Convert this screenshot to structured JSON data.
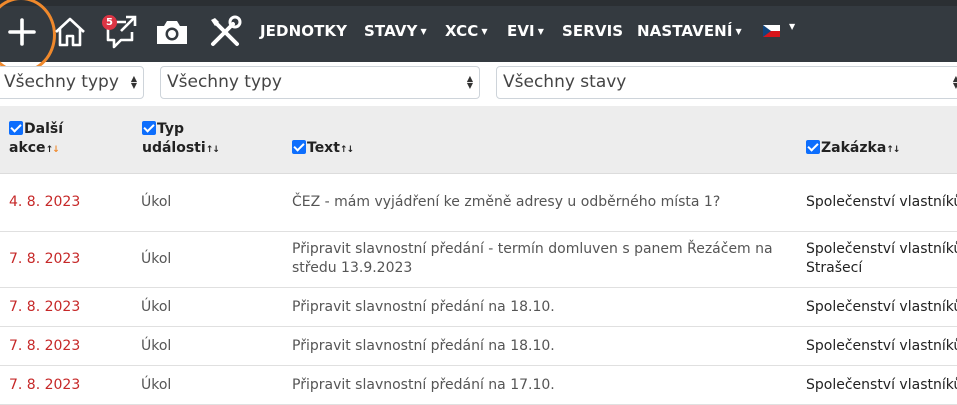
{
  "toolbar": {
    "badge_count": "5",
    "highlight_color": "#f0892c"
  },
  "nav": {
    "items": [
      {
        "label": "JEDNOTKY",
        "dropdown": false
      },
      {
        "label": "STAVY",
        "dropdown": true
      },
      {
        "label": "XCC",
        "dropdown": true
      },
      {
        "label": "EVI",
        "dropdown": true
      },
      {
        "label": "SERVIS",
        "dropdown": false
      },
      {
        "label": "NASTAVENÍ",
        "dropdown": true
      }
    ],
    "language": "cz-flag-icon"
  },
  "filters": {
    "type1": "Všechny typy",
    "type2": "Všechny typy",
    "state": "Všechny stavy"
  },
  "table": {
    "headers": {
      "next_action": [
        "Další",
        "akce"
      ],
      "event_type": [
        "Typ",
        "události"
      ],
      "text": "Text",
      "order": "Zakázka"
    },
    "rows": [
      {
        "date": "4. 8. 2023",
        "type": "Úkol",
        "text": "ČEZ - mám vyjádření ke změně adresy u odběrného místa 1?",
        "order": "Společenství vlastníků"
      },
      {
        "date": "7. 8. 2023",
        "type": "Úkol",
        "text": "Připravit slavnostní předání - termín domluven s panem Řezáčem na středu 13.9.2023",
        "order": "Společenství vlastníků Strašecí"
      },
      {
        "date": "7. 8. 2023",
        "type": "Úkol",
        "text": "Připravit slavnostní předání na 18.10.",
        "order": "Společenství vlastníků"
      },
      {
        "date": "7. 8. 2023",
        "type": "Úkol",
        "text": "Připravit slavnostní předání na 18.10.",
        "order": "Společenství vlastníků"
      },
      {
        "date": "7. 8. 2023",
        "type": "Úkol",
        "text": "Připravit slavnostní předání na 17.10.",
        "order": "Společenství vlastníků"
      }
    ]
  },
  "colors": {
    "navbar": "#343a40",
    "date_text": "#c62828",
    "checkbox": "#0d6efd",
    "header_bg": "#ededed"
  }
}
